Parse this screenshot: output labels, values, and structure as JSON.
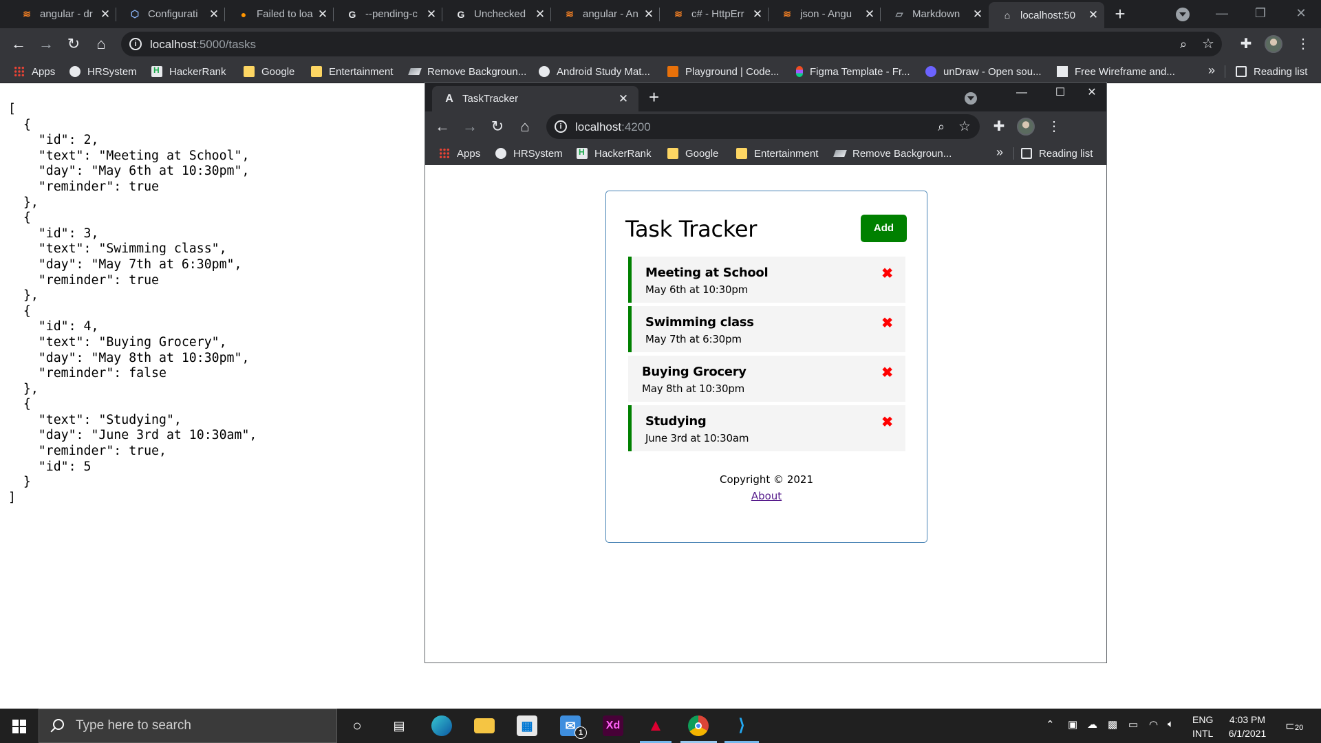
{
  "outer_browser": {
    "tabs": [
      {
        "title": "angular - dr",
        "icon": "stackoverflow-icon"
      },
      {
        "title": "Configurati",
        "icon": "cube-icon"
      },
      {
        "title": "Failed to loa",
        "icon": "firefox-icon"
      },
      {
        "title": "--pending-c",
        "icon": "google-icon"
      },
      {
        "title": "Unchecked",
        "icon": "google-icon"
      },
      {
        "title": "angular - An",
        "icon": "stackoverflow-icon"
      },
      {
        "title": "c# - HttpErr",
        "icon": "stackoverflow-icon"
      },
      {
        "title": "json - Angu",
        "icon": "stackoverflow-icon"
      },
      {
        "title": "Markdown",
        "icon": "markdown-icon"
      },
      {
        "title": "localhost:50",
        "icon": "page-icon"
      }
    ],
    "url_host": "localhost",
    "url_path": ":5000/tasks",
    "bookmarks": [
      {
        "label": "Apps",
        "icon": "apps"
      },
      {
        "label": "HRSystem",
        "icon": "globe"
      },
      {
        "label": "HackerRank",
        "icon": "hr"
      },
      {
        "label": "Google",
        "icon": "folder"
      },
      {
        "label": "Entertainment",
        "icon": "folder"
      },
      {
        "label": "Remove Backgroun...",
        "icon": "layer"
      },
      {
        "label": "Android Study Mat...",
        "icon": "gh"
      },
      {
        "label": "Playground | Code...",
        "icon": "cg"
      },
      {
        "label": "Figma Template - Fr...",
        "icon": "figma"
      },
      {
        "label": "unDraw - Open sou...",
        "icon": "undraw"
      },
      {
        "label": "Free Wireframe and...",
        "icon": "d"
      }
    ],
    "more": "»",
    "reading_list": "Reading list"
  },
  "json_text": "[\n  {\n    \"id\": 2,\n    \"text\": \"Meeting at School\",\n    \"day\": \"May 6th at 10:30pm\",\n    \"reminder\": true\n  },\n  {\n    \"id\": 3,\n    \"text\": \"Swimming class\",\n    \"day\": \"May 7th at 6:30pm\",\n    \"reminder\": true\n  },\n  {\n    \"id\": 4,\n    \"text\": \"Buying Grocery\",\n    \"day\": \"May 8th at 10:30pm\",\n    \"reminder\": false\n  },\n  {\n    \"text\": \"Studying\",\n    \"day\": \"June 3rd at 10:30am\",\n    \"reminder\": true,\n    \"id\": 5\n  }\n]",
  "inner_browser": {
    "tab_title": "TaskTracker",
    "url_host": "localhost",
    "url_path": ":4200",
    "bookmarks": [
      {
        "label": "Apps",
        "icon": "apps"
      },
      {
        "label": "HRSystem",
        "icon": "globe"
      },
      {
        "label": "HackerRank",
        "icon": "hr"
      },
      {
        "label": "Google",
        "icon": "folder"
      },
      {
        "label": "Entertainment",
        "icon": "folder"
      },
      {
        "label": "Remove Backgroun...",
        "icon": "layer"
      }
    ],
    "more": "»",
    "reading_list": "Reading list"
  },
  "app": {
    "title": "Task Tracker",
    "add_label": "Add",
    "delete_glyph": "✖",
    "tasks": [
      {
        "text": "Meeting at School",
        "day": "May 6th at 10:30pm",
        "reminder": true
      },
      {
        "text": "Swimming class",
        "day": "May 7th at 6:30pm",
        "reminder": true
      },
      {
        "text": "Buying Grocery",
        "day": "May 8th at 10:30pm",
        "reminder": false
      },
      {
        "text": "Studying",
        "day": "June 3rd at 10:30am",
        "reminder": true
      }
    ],
    "copyright": "Copyright © 2021",
    "about": "About",
    "colors": {
      "add_button": "#008000",
      "reminder_border": "#008000",
      "delete": "#ff0000",
      "card_border": "#4682b4"
    }
  },
  "taskbar": {
    "search_placeholder": "Type here to search",
    "apps": [
      "cortana-icon",
      "task-view-icon",
      "edge-icon",
      "file-explorer-icon",
      "store-icon",
      "mail-icon",
      "adobe-xd-icon",
      "angular-icon",
      "chrome-icon",
      "vscode-icon"
    ],
    "mail_badge": "1",
    "xd_label": "Xd",
    "lang_line1": "ENG",
    "lang_line2": "INTL",
    "time": "4:03 PM",
    "date": "6/1/2021",
    "notification_count": "20"
  }
}
